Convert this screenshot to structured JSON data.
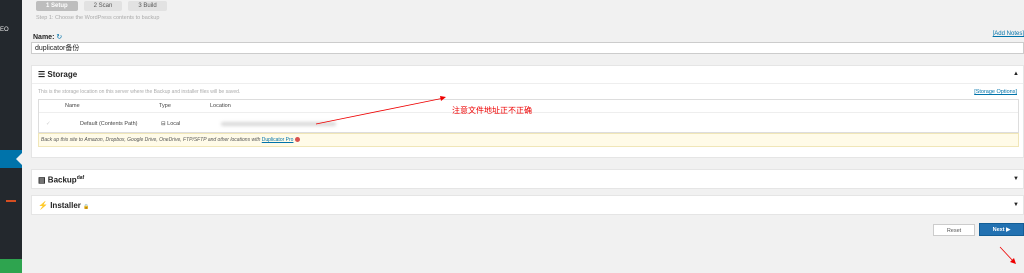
{
  "sidebar": {
    "fragments": [
      "EO",
      "~",
      "/"
    ]
  },
  "steps": [
    {
      "label": "1 Setup"
    },
    {
      "label": "2 Scan"
    },
    {
      "label": "3 Build"
    }
  ],
  "step_description": "Step 1: Choose the WordPress contents to backup",
  "name_field": {
    "label": "Name:",
    "refresh_icon": "↻",
    "value": "duplicator备份",
    "add_notes": "[Add Notes]"
  },
  "storage": {
    "title": "Storage",
    "description": "This is the storage location on this server where the Backup and installer files will be saved.",
    "options_link": "[Storage Options]",
    "columns": [
      "Name",
      "Type",
      "Location"
    ],
    "rows": [
      {
        "check": "✓",
        "name": "Default (Contents Path)",
        "type": "Local"
      }
    ],
    "backup_note_prefix": "Back up this site to",
    "backup_targets": "Amazon, Dropbox, Google Drive, OneDrive, FTP/SFTP and other locations with",
    "pro_link": "Duplicator Pro"
  },
  "annotation": "注意文件地址正不正确",
  "backup": {
    "title": "Backup",
    "sup": "daf"
  },
  "installer": {
    "title": "Installer",
    "lock_icon": "🔒"
  },
  "buttons": {
    "reset": "Reset",
    "next": "Next ▶"
  },
  "colors": {
    "annotation": "#e00000",
    "primary": "#2271b1",
    "sidebar": "#23282d"
  }
}
